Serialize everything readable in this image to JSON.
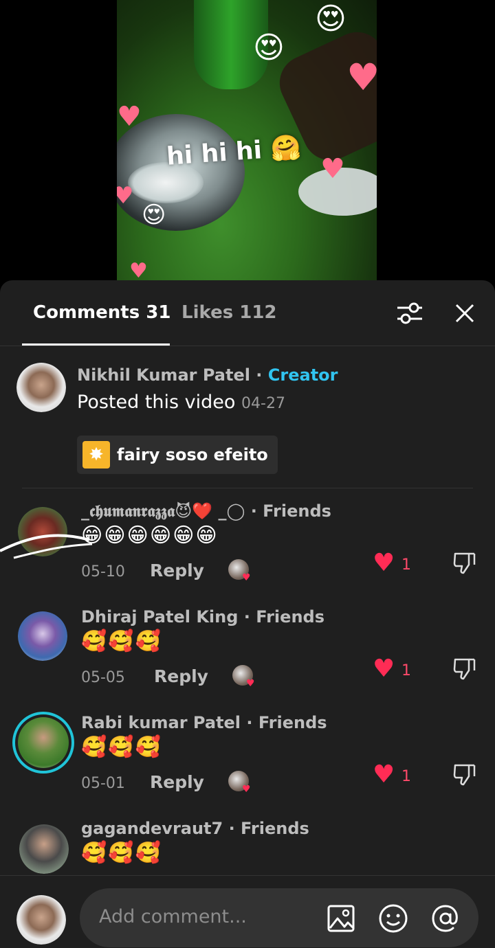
{
  "video": {
    "overlay_text": "hi hi hi 🤗"
  },
  "tabs": {
    "comments_label": "Comments 31",
    "likes_label": "Likes 112"
  },
  "creator_post": {
    "name": "Nikhil Kumar Patel",
    "separator": " · ",
    "tag": "Creator",
    "posted_text": "Posted this video",
    "date": "04-27",
    "effect_label": "fairy soso efeito"
  },
  "comments": [
    {
      "name": "_𝖈𝖍𝖚𝖒𝖆𝖓𝖗𝖆𝖟𝖟𝖆😈❤️ _◯ · Friends",
      "text": "😁😁😁😁😁😁",
      "date": "05-10",
      "reply_label": "Reply",
      "likes": "1"
    },
    {
      "name": "Dhiraj Patel King · Friends",
      "text": "🥰🥰🥰",
      "date": "05-05",
      "reply_label": "Reply",
      "likes": "1"
    },
    {
      "name": "Rabi kumar Patel · Friends",
      "text": "🥰🥰🥰",
      "date": "05-01",
      "reply_label": "Reply",
      "likes": "1"
    },
    {
      "name": "gagandevraut7 · Friends",
      "text": "🥰🥰🥰"
    }
  ],
  "input": {
    "placeholder": "Add comment..."
  },
  "colors": {
    "panel_bg": "#1f1f1f",
    "creator_tag": "#31c4f0",
    "like_red": "#ff2c55"
  },
  "icons": [
    "filter-sliders-icon",
    "close-icon",
    "heart-icon",
    "dislike-icon",
    "image-icon",
    "emoji-icon",
    "mention-icon"
  ]
}
